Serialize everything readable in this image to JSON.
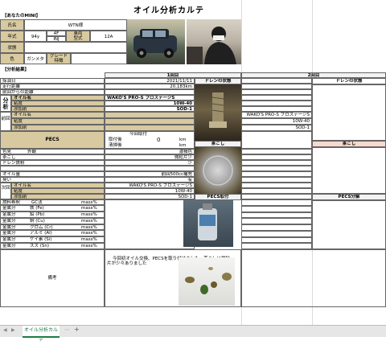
{
  "sheet": {
    "title": "オイル分析カルテ",
    "section_you": "【あなたのMINI】",
    "section_results": "【分析結果】"
  },
  "vehicle": {
    "name_label": "氏名",
    "name_value": "WTN様",
    "year_label": "年式",
    "year_value": "94y",
    "doors": "4F",
    "engine": "INJ",
    "model_label": "車両\n型式",
    "model_value": "12A",
    "state_label": "状態",
    "color_label": "色",
    "color_value": "ガンメタ",
    "grade_label": "グレード\n特徴"
  },
  "rows": {
    "date": "採油日",
    "mileage": "走行距離",
    "prev_distance": "前回からの距離",
    "analysis": "分析",
    "oil_name": "オイル名",
    "viscosity": "粘度",
    "additive": "添加剤",
    "previous": "前回",
    "pecs": "PECS",
    "color": "色見",
    "appearance": "外観",
    "filter": "茶こし",
    "drain_plug": "ドレン鉄粉",
    "oil_qty": "オイル量",
    "smell": "臭い",
    "next": "次回",
    "contaminant": "混入物",
    "exhaust": "燃料希釈",
    "gc_method": "GC法",
    "metal": "金属分",
    "remarks": "備考"
  },
  "metals": [
    {
      "name": "鉄 (Fe)",
      "unit": "mass%"
    },
    {
      "name": "鉛 (Pb)",
      "unit": "mass%"
    },
    {
      "name": "銅 (Cu)",
      "unit": "mass%"
    },
    {
      "name": "クロム (Cr)",
      "unit": "mass%"
    },
    {
      "name": "アルミ (Al)",
      "unit": "mass%"
    },
    {
      "name": "ケイ素 (Si)",
      "unit": "mass%"
    },
    {
      "name": "スズ (Sn)",
      "unit": "mass%"
    }
  ],
  "round1": {
    "header": "1回目",
    "date": "2021/11/11",
    "mileage": "20,183km",
    "oil_name": "WAKO'S PRO-S プロステージS",
    "viscosity": "10W-40",
    "additive": "SOD-1",
    "prev_oil": "WAKO'S PRO-S プロステージS",
    "prev_visc": "10W-40",
    "prev_add": "SOD-1",
    "pecs_label": "今回取付",
    "pecs_rows": [
      "取付後",
      "清掃後"
    ],
    "pecs_units": [
      "0",
      "km"
    ],
    "appearance": "濃褐色",
    "filter": "微粒片少",
    "drain": "少",
    "oil_qty": "前回500cc補充",
    "smell": "有",
    "next_oil": "WAKO'S PRO-S プロステージS",
    "next_visc": "10W-40",
    "next_add": "SOD-1",
    "drain_header": "ドレンの状態",
    "filter_header": "茶こし",
    "pecs_header": "PECS取付",
    "remarks": "今回初オイル交換、PECSを取り付けました。茶こしに微粒\n片が少々ありました"
  },
  "round2": {
    "header": "2回目",
    "drain_header": "ドレンの状態",
    "oil_name": "WAKO'S PRO-S プロステージS",
    "viscosity": "10W-40",
    "additive": "SOD-1",
    "filter_header": "茶こし",
    "pecs_header": "PECS分解"
  },
  "tabs": {
    "active": "オイル分析カルテ",
    "add": "+"
  },
  "colors": {
    "tan": "#d8c9a0",
    "pink": "#f9d9cf",
    "accent": "#1e7b45"
  }
}
